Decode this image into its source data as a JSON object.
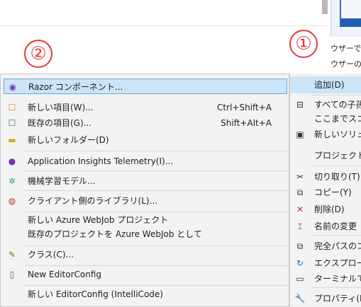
{
  "background": {
    "line1": "ウザーで表",
    "line2": "ウザーの追"
  },
  "callouts": {
    "left": "②",
    "right": "①",
    "color": "#e53935"
  },
  "submenu": {
    "items": [
      {
        "label": "Razor コンポーネント...",
        "shortcut": "",
        "icon": "razor-component-icon",
        "highlighted": true
      },
      {
        "label": "新しい項目(W)...",
        "shortcut": "Ctrl+Shift+A",
        "icon": "new-item-icon"
      },
      {
        "label": "既存の項目(G)...",
        "shortcut": "Shift+Alt+A",
        "icon": "existing-item-icon"
      },
      {
        "label": "新しいフォルダー(D)",
        "shortcut": "",
        "icon": "new-folder-icon"
      },
      {
        "label": "Application Insights Telemetry(I)...",
        "shortcut": "",
        "icon": "app-insights-icon"
      },
      {
        "label": "機械学習モデル...",
        "shortcut": "",
        "icon": "ml-model-icon"
      },
      {
        "label": "クライアント側のライブラリ(L)...",
        "shortcut": "",
        "icon": "client-library-icon"
      },
      {
        "label": "新しい Azure WebJob プロジェクト",
        "shortcut": "",
        "icon": ""
      },
      {
        "label": "既存のプロジェクトを Azure WebJob として",
        "shortcut": "",
        "icon": ""
      },
      {
        "label": "クラス(C)...",
        "shortcut": "",
        "icon": "class-icon"
      },
      {
        "label": "New EditorConfig",
        "shortcut": "",
        "icon": "editorconfig-icon"
      },
      {
        "label": "新しい EditorConfig (IntelliCode)",
        "shortcut": "",
        "icon": ""
      }
    ]
  },
  "context_menu": {
    "items": [
      {
        "label": "追加(D)",
        "icon": "",
        "active": true
      },
      {
        "label": "すべての子孫",
        "icon": "collapse-icon"
      },
      {
        "label": "ここまでスコー",
        "icon": ""
      },
      {
        "label": "新しいソリュー",
        "icon": "new-solution-icon"
      },
      {
        "label": "プロジェクトか",
        "icon": ""
      },
      {
        "label": "切り取り(T)",
        "icon": "scissors-icon"
      },
      {
        "label": "コピー(Y)",
        "icon": "copy-icon"
      },
      {
        "label": "削除(D)",
        "icon": "delete-icon"
      },
      {
        "label": "名前の変更",
        "icon": "rename-icon"
      },
      {
        "label": "完全パスのコ",
        "icon": "copy-path-icon"
      },
      {
        "label": "エクスプロー",
        "icon": "refresh-icon"
      },
      {
        "label": "ターミナルで開",
        "icon": "terminal-icon"
      },
      {
        "label": "プロパティ(R)",
        "icon": "wrench-icon"
      }
    ]
  }
}
